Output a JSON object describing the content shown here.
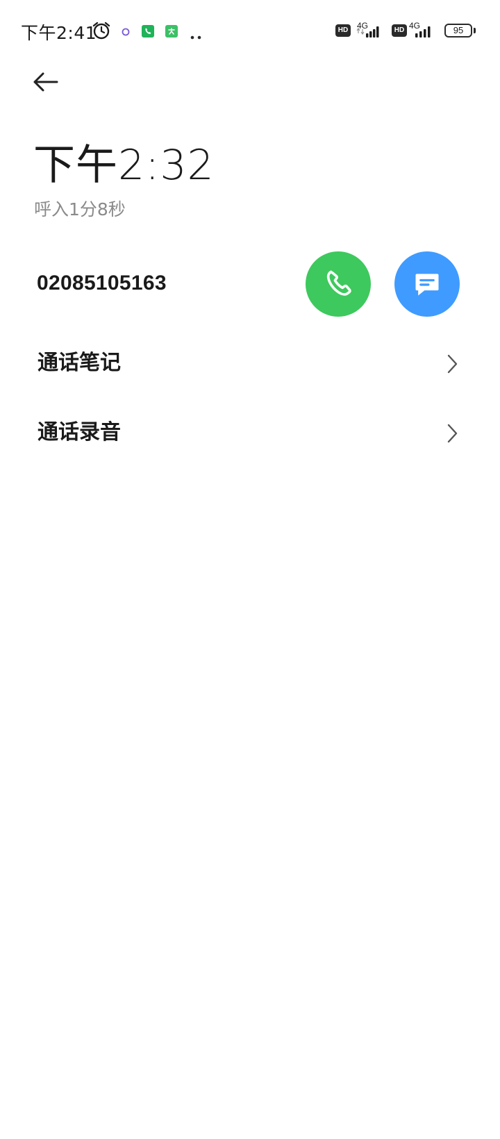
{
  "status_bar": {
    "time": "下午2:41",
    "hd_label": "HD",
    "network_1": "4G",
    "network_2": "4G",
    "battery": "95",
    "icons": [
      "alarm-icon",
      "ring-icon",
      "phone-app-icon",
      "pay-app-icon",
      "more-dots-icon",
      "signal-icon",
      "battery-icon"
    ]
  },
  "header": {
    "back_icon": "arrow-left-icon"
  },
  "call": {
    "time": "下午2:32",
    "subtitle": "呼入1分8秒",
    "number": "02085105163"
  },
  "actions": {
    "call_icon": "phone-icon",
    "message_icon": "message-icon",
    "call_color": "#3dc95d",
    "message_color": "#3f9bff"
  },
  "rows": [
    {
      "label": "通话笔记",
      "icon": "chevron-right-icon"
    },
    {
      "label": "通话录音",
      "icon": "chevron-right-icon"
    }
  ]
}
